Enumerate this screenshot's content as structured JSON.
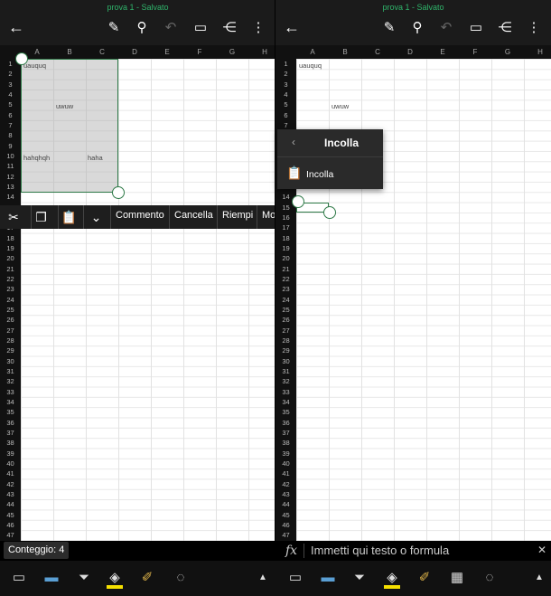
{
  "window": {
    "title": "prova 1 - Salvato"
  },
  "columns": [
    "A",
    "B",
    "C",
    "D",
    "E",
    "F",
    "G",
    "H"
  ],
  "rows": [
    "1",
    "2",
    "3",
    "4",
    "5",
    "6",
    "7",
    "8",
    "9",
    "10",
    "11",
    "12",
    "13",
    "14",
    "15",
    "16",
    "17",
    "18",
    "19",
    "20",
    "21",
    "22",
    "23",
    "24",
    "25",
    "26",
    "27",
    "28",
    "29",
    "30",
    "31",
    "32",
    "33",
    "34",
    "35",
    "36",
    "37",
    "38",
    "39",
    "40",
    "41",
    "42",
    "43",
    "44",
    "45",
    "46",
    "47"
  ],
  "cells": {
    "a1": "uauquq",
    "b5": "uwuw",
    "a10": "hahqhqh",
    "c10": "haha"
  },
  "toolbar": {
    "back_icon": "back-arrow-icon",
    "draw_icon": "pen-icon",
    "search_icon": "search-icon",
    "undo_icon": "undo-icon",
    "comment_icon": "comment-icon",
    "share_icon": "share-icon",
    "more_icon": "more-icon"
  },
  "context_menu": {
    "items": [
      "Commento",
      "Cancella",
      "Riempi",
      "Mo"
    ]
  },
  "paste_popup": {
    "title": "Incolla",
    "item": "Incolla"
  },
  "status": {
    "count_label": "Conteggio: 4"
  },
  "formula_bar": {
    "fx": "fx",
    "placeholder": "Immetti qui testo o formula"
  },
  "colors": {
    "accent": "#2f7a48",
    "title": "#2fb36a",
    "highlight": "#f5e000"
  }
}
